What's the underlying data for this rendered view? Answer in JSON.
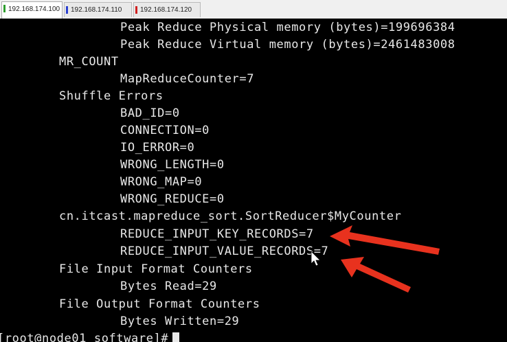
{
  "tabs": [
    {
      "label": "192.168.174.100",
      "active": true,
      "color": "#2e9e2e"
    },
    {
      "label": "192.168.174.110",
      "active": false,
      "color": "#2a3fd0"
    },
    {
      "label": "192.168.174.120",
      "active": false,
      "color": "#d02020"
    }
  ],
  "terminal": {
    "lines": [
      "Peak Reduce Physical memory (bytes)=199696384",
      "Peak Reduce Virtual memory (bytes)=2461483008",
      "MR_COUNT",
      "MapReduceCounter=7",
      "Shuffle Errors",
      "BAD_ID=0",
      "CONNECTION=0",
      "IO_ERROR=0",
      "WRONG_LENGTH=0",
      "WRONG_MAP=0",
      "WRONG_REDUCE=0",
      "cn.itcast.mapreduce_sort.SortReducer$MyCounter",
      "REDUCE_INPUT_KEY_RECORDS=7",
      "REDUCE_INPUT_VALUE_RECORDS=7",
      "File Input Format Counters",
      "Bytes Read=29",
      "File Output Format Counters",
      "Bytes Written=29"
    ],
    "prompt": "[root@node01 software]#"
  },
  "colors": {
    "background": "#000000",
    "text": "#e8e8e8",
    "arrow": "#e8321e"
  },
  "annotations": [
    {
      "name": "arrow-to-key-records",
      "points_to": "REDUCE_INPUT_KEY_RECORDS=7"
    },
    {
      "name": "arrow-to-value-records",
      "points_to": "REDUCE_INPUT_VALUE_RECORDS=7"
    }
  ]
}
